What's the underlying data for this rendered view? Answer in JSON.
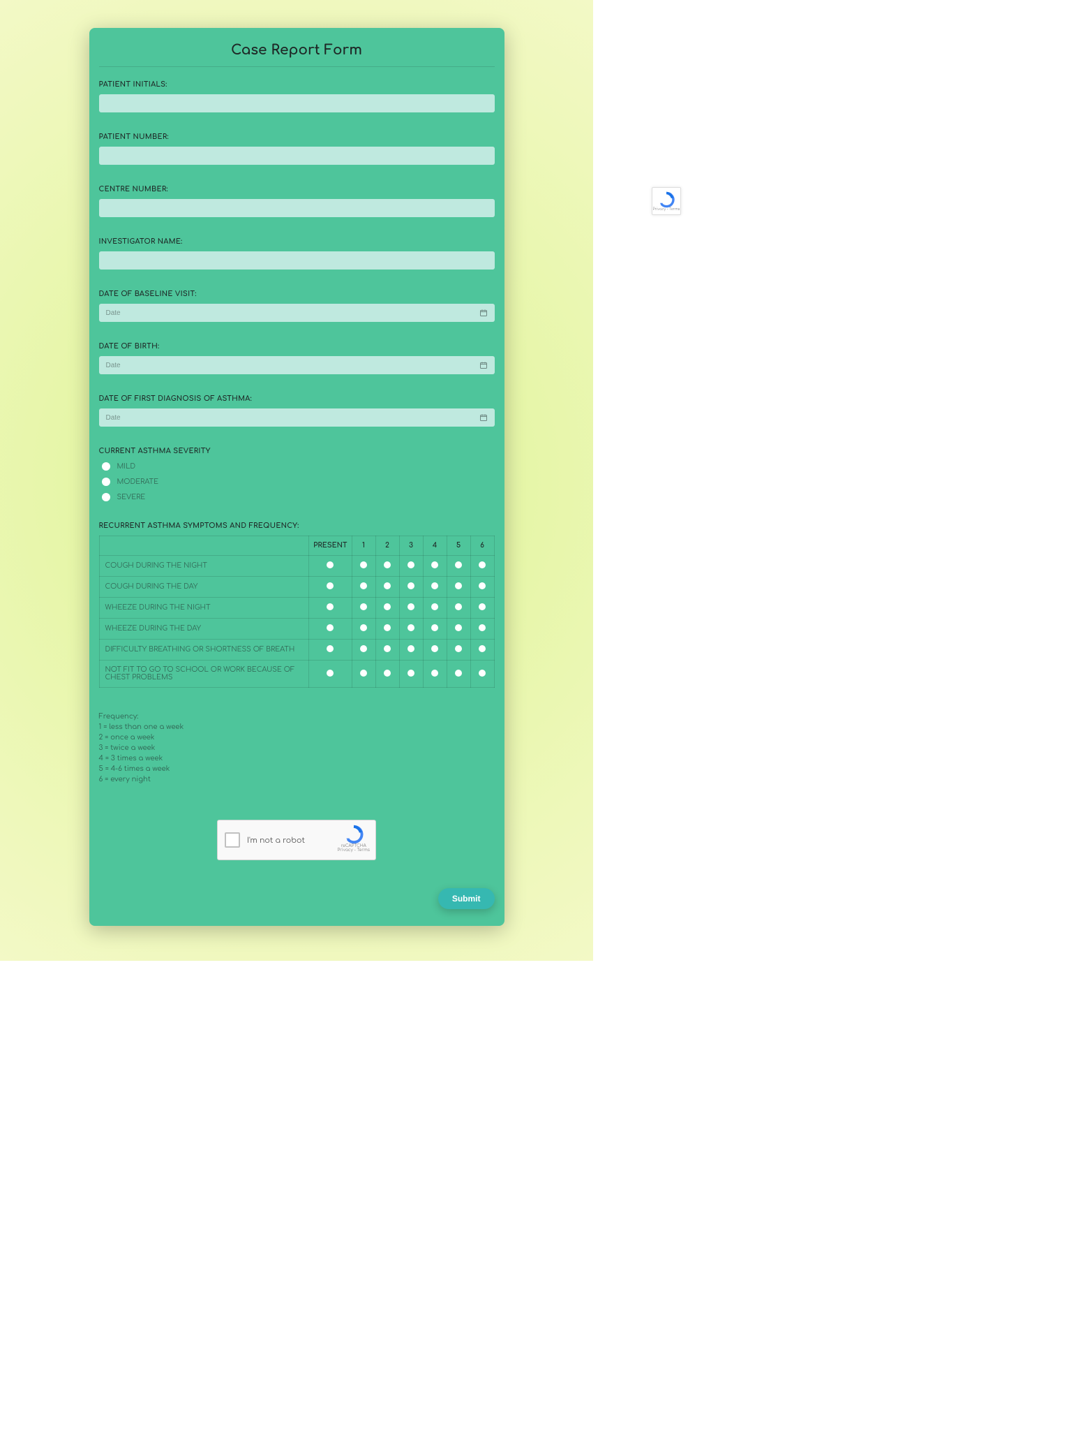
{
  "form": {
    "title": "Case Report Form",
    "fields": {
      "patient_initials": {
        "label": "PATIENT INITIALS:",
        "value": ""
      },
      "patient_number": {
        "label": "PATIENT NUMBER:",
        "value": ""
      },
      "centre_number": {
        "label": "CENTRE NUMBER:",
        "value": ""
      },
      "investigator_name": {
        "label": "INVESTIGATOR NAME:",
        "value": ""
      },
      "baseline_visit": {
        "label": "DATE OF BASELINE VISIT:",
        "placeholder": "Date",
        "value": ""
      },
      "dob": {
        "label": "DATE OF BIRTH:",
        "placeholder": "Date",
        "value": ""
      },
      "first_diagnosis": {
        "label": "DATE OF FIRST DIAGNOSIS OF ASTHMA:",
        "placeholder": "Date",
        "value": ""
      }
    },
    "severity": {
      "label": "CURRENT ASTHMA SEVERITY",
      "options": [
        "MILD",
        "MODERATE",
        "SEVERE"
      ]
    },
    "symptoms": {
      "label": "RECURRENT ASTHMA SYMPTOMS AND FREQUENCY:",
      "columns": [
        "PRESENT",
        "1",
        "2",
        "3",
        "4",
        "5",
        "6"
      ],
      "rows": [
        "COUGH DURING THE NIGHT",
        "COUGH DURING THE DAY",
        "WHEEZE DURING THE NIGHT",
        "WHEEZE DURING THE DAY",
        "DIFFICULTY BREATHING OR SHORTNESS OF BREATH",
        "NOT FIT TO GO TO SCHOOL OR WORK BECAUSE OF CHEST PROBLEMS"
      ]
    },
    "frequency_legend": {
      "title": "Frequency:",
      "lines": [
        "1 = less than one a week",
        "2 = once a week",
        "3 = twice a week",
        "4 = 3 times a week",
        "5 = 4-6 times a week",
        "6 = every night"
      ]
    },
    "captcha": {
      "label": "I'm not a robot",
      "brand": "reCAPTCHA",
      "terms": "Privacy - Terms"
    },
    "submit_label": "Submit"
  }
}
